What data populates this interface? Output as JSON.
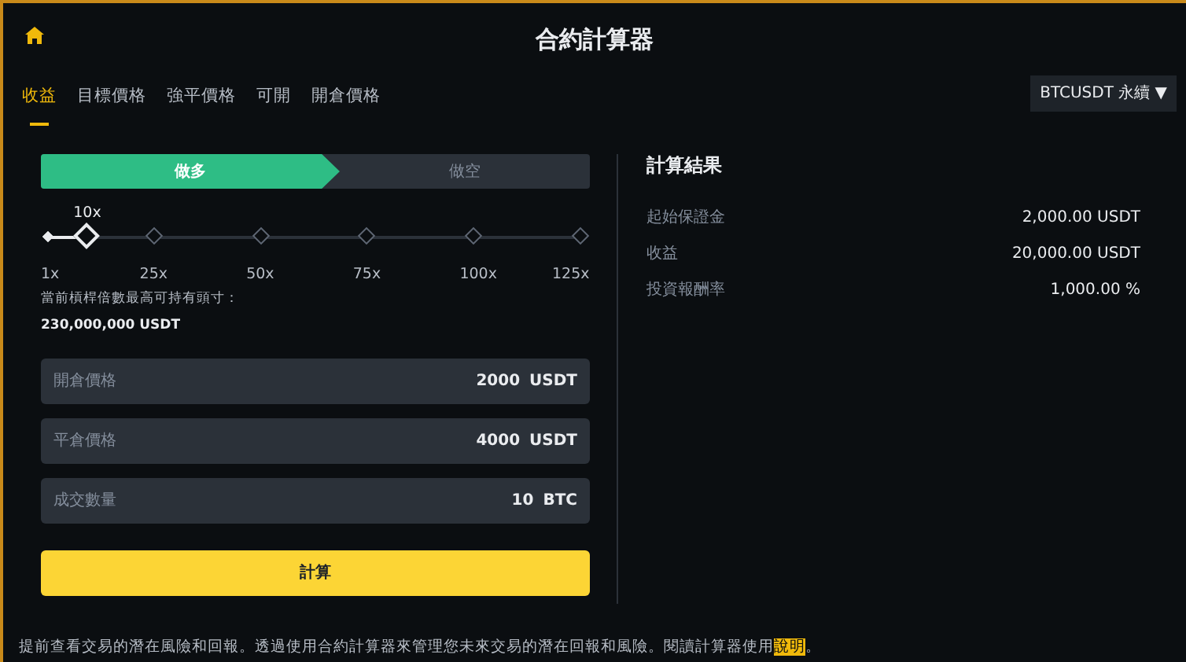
{
  "header": {
    "title": "合約計算器"
  },
  "tabs": [
    {
      "label": "收益",
      "selected": true
    },
    {
      "label": "目標價格",
      "selected": false
    },
    {
      "label": "強平價格",
      "selected": false
    },
    {
      "label": "可開",
      "selected": false
    },
    {
      "label": "開倉價格",
      "selected": false
    }
  ],
  "symbol_dropdown": {
    "value": "BTCUSDT 永續",
    "caret": "▼"
  },
  "side_toggle": [
    {
      "label": "做多",
      "selected": true
    },
    {
      "label": "做空",
      "selected": false
    }
  ],
  "leverage": {
    "reading": "10x",
    "level": 0.0726,
    "ticks": [
      "1x",
      "25x",
      "50x",
      "75x",
      "100x",
      "125x"
    ],
    "note": "當前槓桿倍數最高可持有頭寸：",
    "max_position": "230,000,000 USDT"
  },
  "fields": [
    {
      "label": "開倉價格",
      "value": "2000",
      "unit": "USDT"
    },
    {
      "label": "平倉價格",
      "value": "4000",
      "unit": "USDT"
    },
    {
      "label": "成交數量",
      "value": "10",
      "unit": "BTC"
    }
  ],
  "calculate_button": "計算",
  "results": {
    "title": "計算結果",
    "rows": [
      {
        "label": "起始保證金",
        "value": "2,000.00 USDT"
      },
      {
        "label": "收益",
        "value": "20,000.00 USDT"
      },
      {
        "label": "投資報酬率",
        "value": "1,000.00 %"
      }
    ]
  },
  "footer": {
    "text": "提前查看交易的潛在風險和回報。透過使用合約計算器來管理您未來交易的潛在回報和風險。閱讀計算器使用",
    "link": "說明",
    "tail": "。"
  }
}
